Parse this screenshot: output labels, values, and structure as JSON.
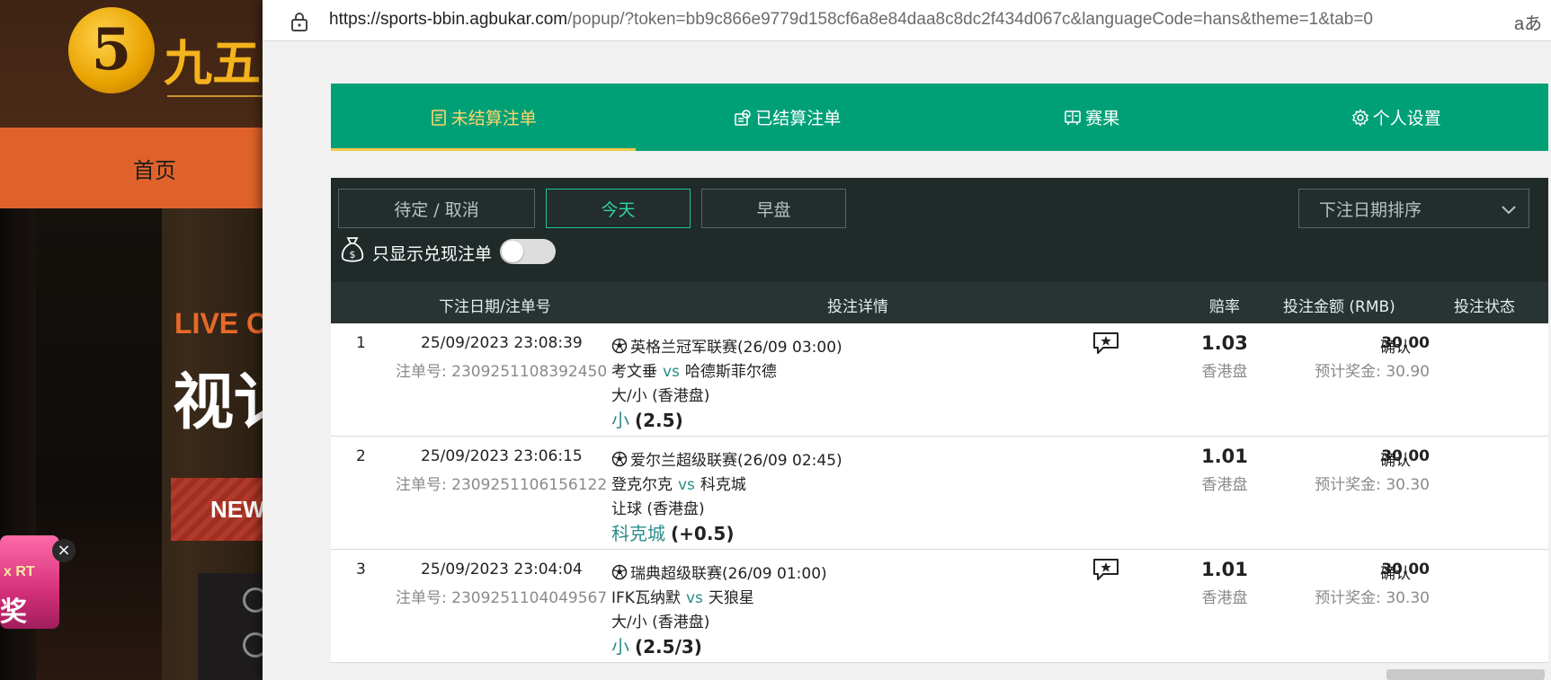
{
  "background": {
    "logo_char": "5",
    "logo_text": "九五",
    "nav_home": "首页",
    "live_text": "LIVE C",
    "video_text": "视讠",
    "new_text": "NEW",
    "promo_text1": "x RT",
    "promo_text2": "奖",
    "promo_close": "×"
  },
  "browser": {
    "url_host": "https://sports-bbin.agbukar.com",
    "url_path": "/popup/?token=bb9c866e9779d158cf6a8e84daa8c8dc2f434d067c&languageCode=hans&theme=1&tab=0",
    "read_aloud": "aあ"
  },
  "tabs": [
    {
      "label": "未结算注单",
      "icon": "receipt-icon",
      "active": true
    },
    {
      "label": "已结算注单",
      "icon": "settled-icon",
      "active": false
    },
    {
      "label": "赛果",
      "icon": "scoreboard-icon",
      "active": false
    },
    {
      "label": "个人设置",
      "icon": "gear-icon",
      "active": false
    }
  ],
  "filters": {
    "pending_label": "待定 / 取消",
    "today_label": "今天",
    "early_label": "早盘",
    "sort_label": "下注日期排序",
    "only_cashout_label": "只显示兑现注单",
    "only_cashout_on": false
  },
  "columns": {
    "date": "下注日期/注单号",
    "detail": "投注详情",
    "odds": "赔率",
    "amount": "投注金额 (RMB)",
    "status": "投注状态"
  },
  "bets": [
    {
      "idx": "1",
      "date": "25/09/2023 23:08:39",
      "ticket": "注单号: 2309251108392450",
      "league": "英格兰冠军联赛(26/09 03:00)",
      "home": "考文垂",
      "vs": "vs",
      "away": "哈德斯菲尔德",
      "market": "大/小 (香港盘)",
      "selection": "小",
      "line": "(2.5)",
      "has_chat": true,
      "odds": "1.03",
      "odds_type": "香港盘",
      "amount": "30.00",
      "payout": "预计奖金: 30.90",
      "status": "确认"
    },
    {
      "idx": "2",
      "date": "25/09/2023 23:06:15",
      "ticket": "注单号: 2309251106156122",
      "league": "爱尔兰超级联赛(26/09 02:45)",
      "home": "登克尔克",
      "vs": "vs",
      "away": "科克城",
      "market": "让球 (香港盘)",
      "selection": "科克城",
      "line": "(+0.5)",
      "has_chat": false,
      "odds": "1.01",
      "odds_type": "香港盘",
      "amount": "30.00",
      "payout": "预计奖金: 30.30",
      "status": "确认"
    },
    {
      "idx": "3",
      "date": "25/09/2023 23:04:04",
      "ticket": "注单号: 2309251104049567",
      "league": "瑞典超级联赛(26/09 01:00)",
      "home": "IFK瓦纳默",
      "vs": "vs",
      "away": "天狼星",
      "market": "大/小 (香港盘)",
      "selection": "小",
      "line": "(2.5/3)",
      "has_chat": true,
      "odds": "1.01",
      "odds_type": "香港盘",
      "amount": "30.00",
      "payout": "预计奖金: 30.30",
      "status": "确认"
    }
  ]
}
